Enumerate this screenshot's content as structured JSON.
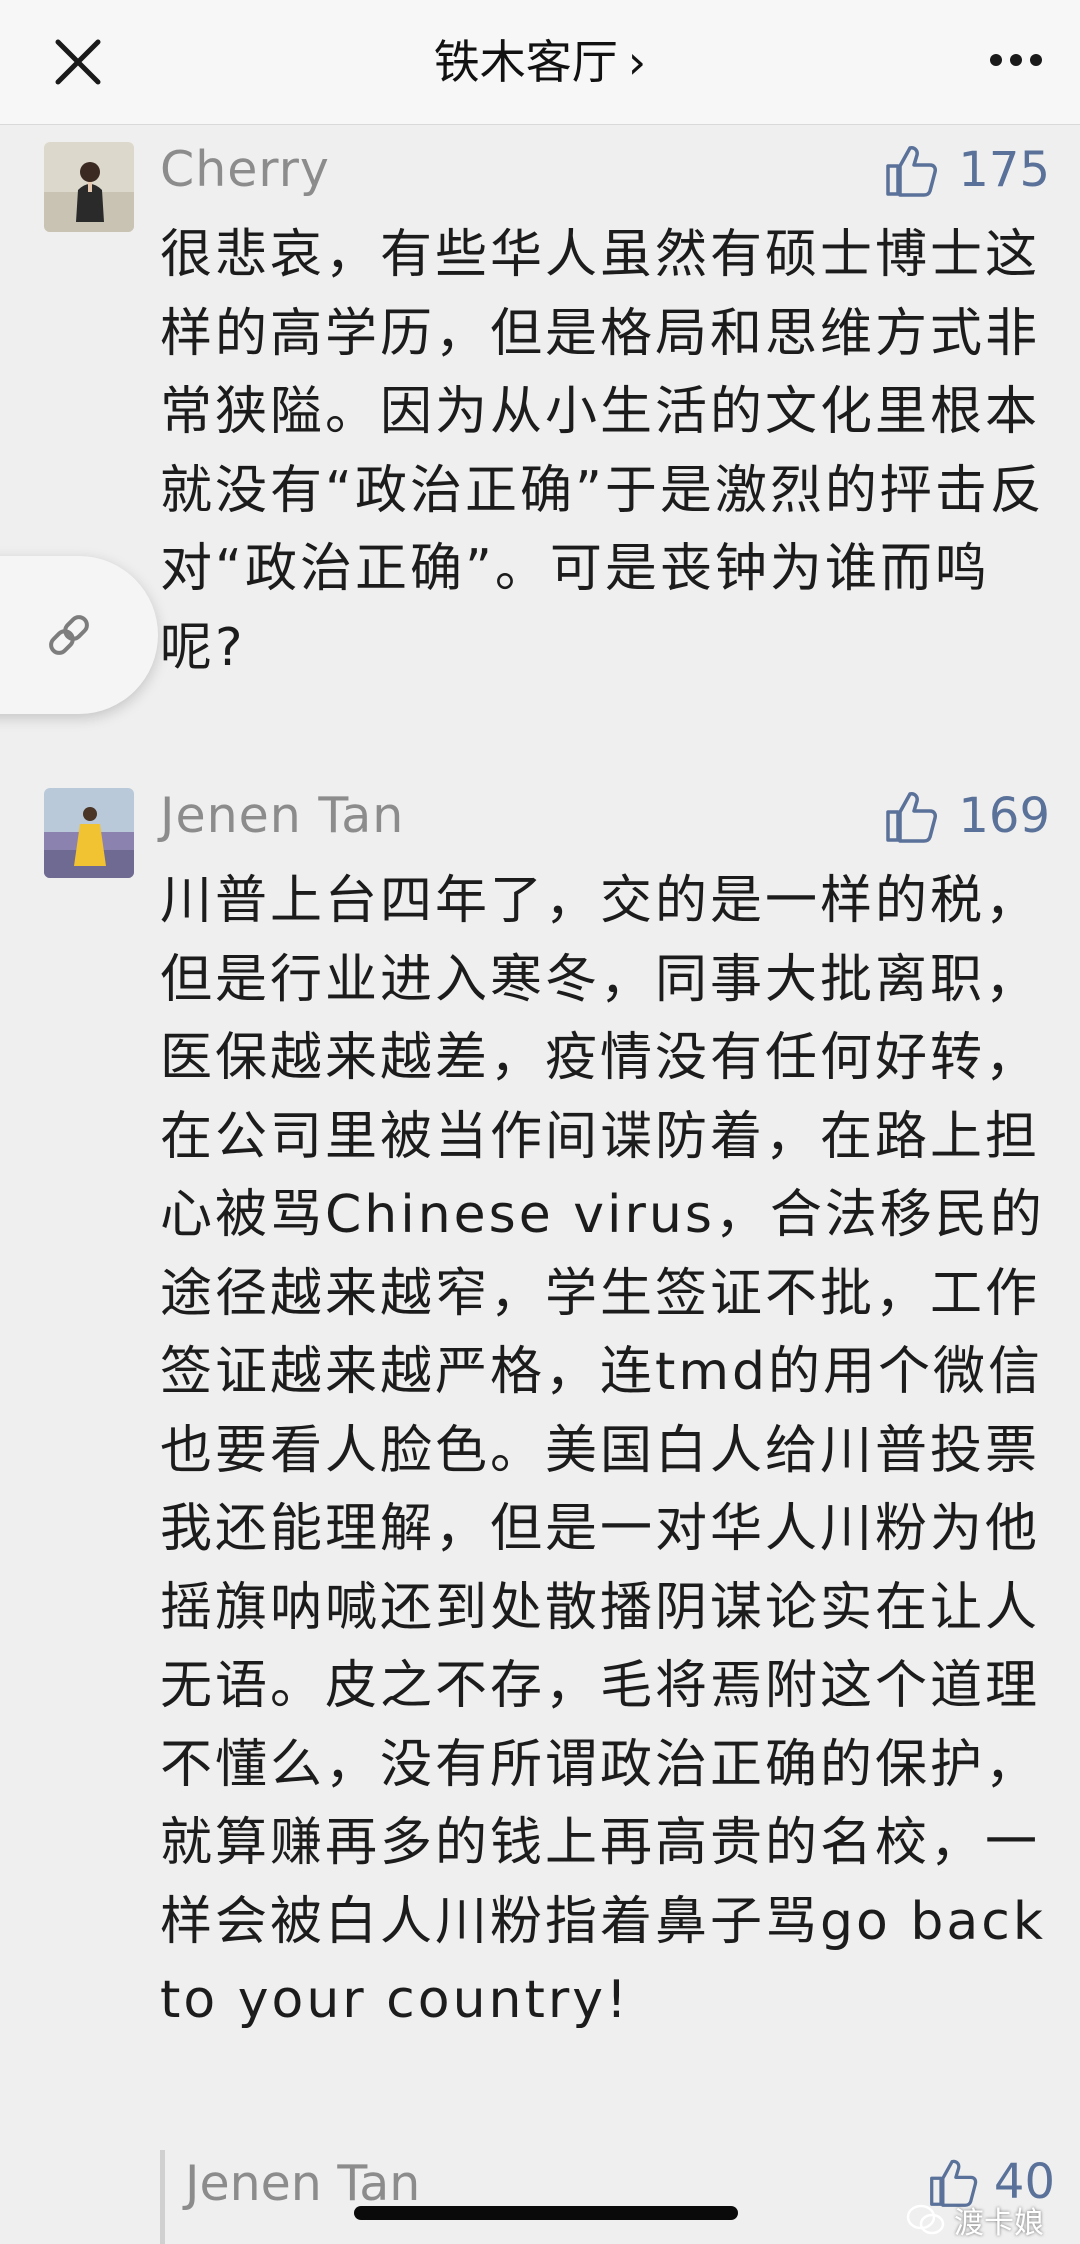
{
  "header": {
    "title": "铁木客厅",
    "chevron": "›",
    "close_icon": "close-icon",
    "more_icon": "more-horizontal-icon"
  },
  "comments": [
    {
      "nickname": "Cherry",
      "likes": "175",
      "text": "很悲哀，有些华人虽然有硕士博士这样的高学历，但是格局和思维方式非常狭隘。因为从小生活的文化里根本就没有“政治正确”于是激烈的抨击反对“政治正确”。可是丧钟为谁而鸣呢?"
    },
    {
      "nickname": "Jenen Tan",
      "likes": "169",
      "text": "川普上台四年了，交的是一样的税，但是行业进入寒冬，同事大批离职，医保越来越差，疫情没有任何好转，在公司里被当作间谍防着，在路上担心被骂Chinese virus，合法移民的途径越来越窄，学生签证不批，工作签证越来越严格，连tmd的用个微信也要看人脸色。美国白人给川普投票我还能理解，但是一对华人川粉为他摇旗呐喊还到处散播阴谋论实在让人无语。皮之不存，毛将焉附这个道理不懂么，没有所谓政治正确的保护，就算赚再多的钱上再高贵的名校，一样会被白人川粉指着鼻子骂go back to your country!"
    }
  ],
  "reply": {
    "nickname": "Jenen Tan",
    "likes": "40"
  },
  "watermark": "渡卡娘",
  "colors": {
    "accent": "#5a7199",
    "nickname": "#8c8c8c",
    "background": "#efefef"
  }
}
